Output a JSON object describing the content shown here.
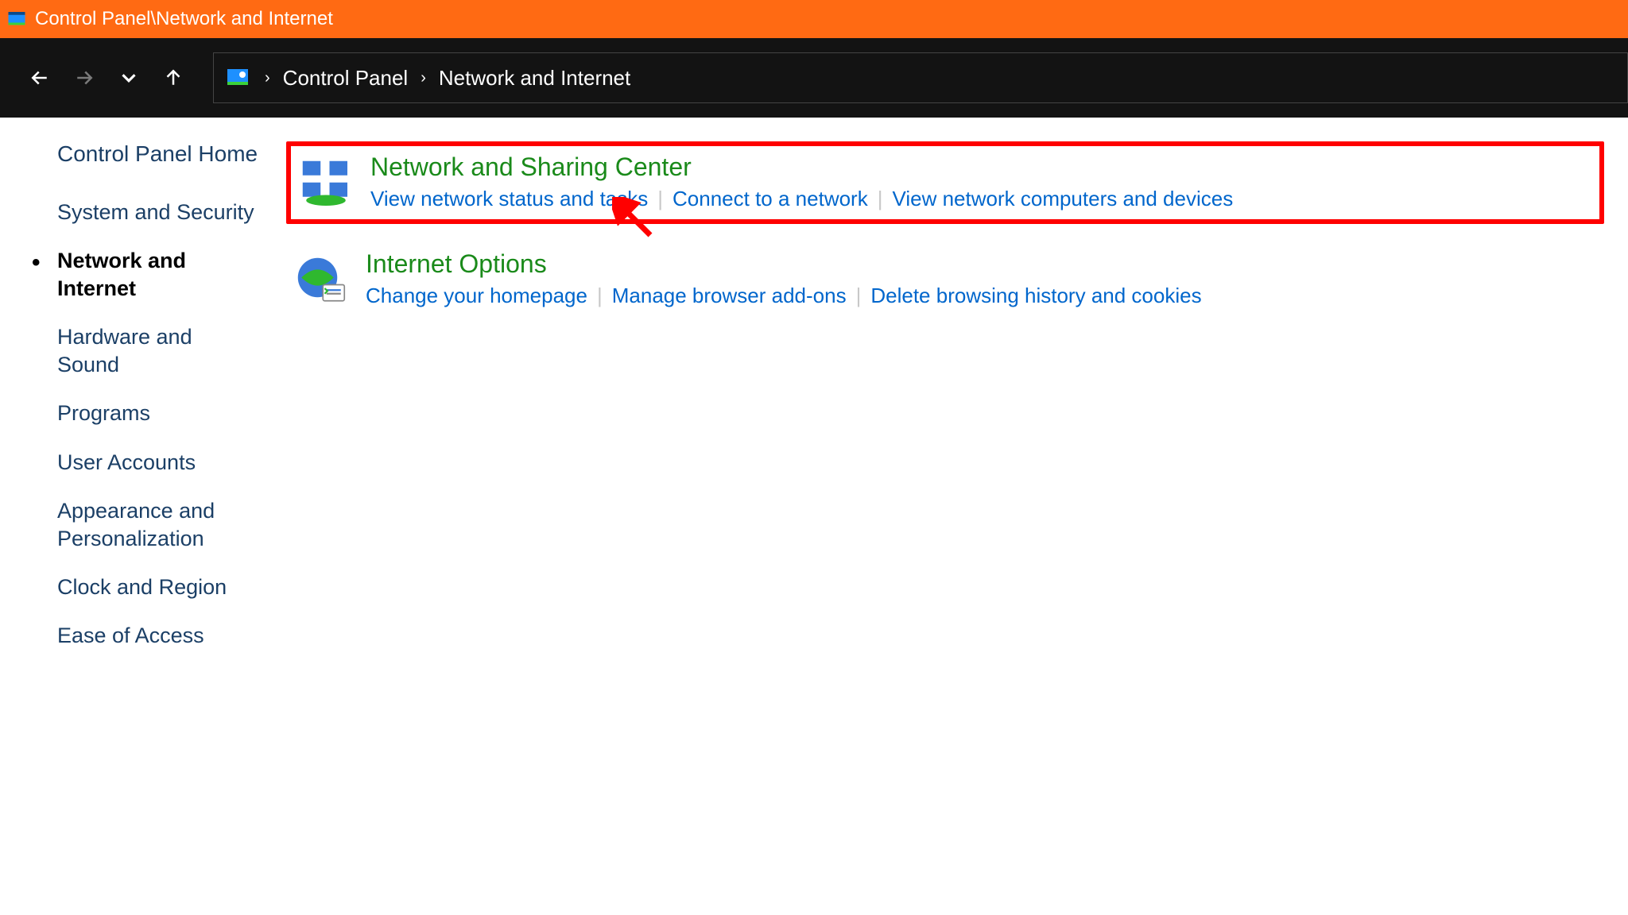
{
  "window_title": "Control Panel\\Network and Internet",
  "breadcrumb": {
    "root": "Control Panel",
    "current": "Network and Internet"
  },
  "sidebar": {
    "home": "Control Panel Home",
    "items": [
      {
        "label": "System and Security",
        "active": false
      },
      {
        "label": "Network and Internet",
        "active": true
      },
      {
        "label": "Hardware and Sound",
        "active": false
      },
      {
        "label": "Programs",
        "active": false
      },
      {
        "label": "User Accounts",
        "active": false
      },
      {
        "label": "Appearance and Personalization",
        "active": false
      },
      {
        "label": "Clock and Region",
        "active": false
      },
      {
        "label": "Ease of Access",
        "active": false
      }
    ]
  },
  "categories": [
    {
      "title": "Network and Sharing Center",
      "highlighted": true,
      "links": [
        "View network status and tasks",
        "Connect to a network",
        "View network computers and devices"
      ]
    },
    {
      "title": "Internet Options",
      "highlighted": false,
      "links": [
        "Change your homepage",
        "Manage browser add-ons",
        "Delete browsing history and cookies"
      ]
    }
  ]
}
